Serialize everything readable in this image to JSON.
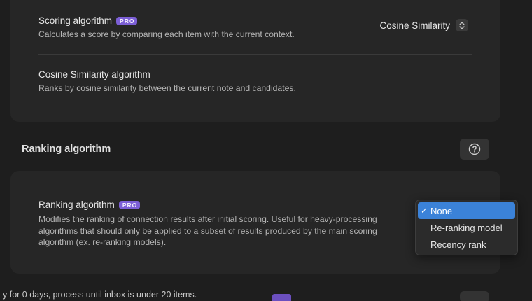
{
  "scoring": {
    "title": "Scoring algorithm",
    "badge": "PRO",
    "description": "Calculates a score by comparing each item with the current context.",
    "selected_value": "Cosine Similarity"
  },
  "cosine": {
    "title": "Cosine Similarity algorithm",
    "description": "Ranks by cosine similarity between the current note and candidates."
  },
  "ranking_section": {
    "heading": "Ranking algorithm",
    "help_icon": "question-circle-icon"
  },
  "ranking": {
    "title": "Ranking algorithm",
    "badge": "PRO",
    "description_lines": [
      "Modifies the ranking of connection results after initial scoring. Useful for heavy-processing",
      "algorithms that should only be applied to a subset of results produced by the main scoring",
      "algorithm (ex. re-ranking models)."
    ]
  },
  "dropdown": {
    "options": [
      "None",
      "Re-ranking model",
      "Recency rank"
    ],
    "selected": "None",
    "check": "✓"
  },
  "bottom_strip": {
    "text": "y for 0 days, process until inbox is under 20 items."
  },
  "colors": {
    "background": "#1e1e1e",
    "card": "#262626",
    "pro_badge": "#7c5fd6",
    "selected_option": "#3b82d8"
  }
}
